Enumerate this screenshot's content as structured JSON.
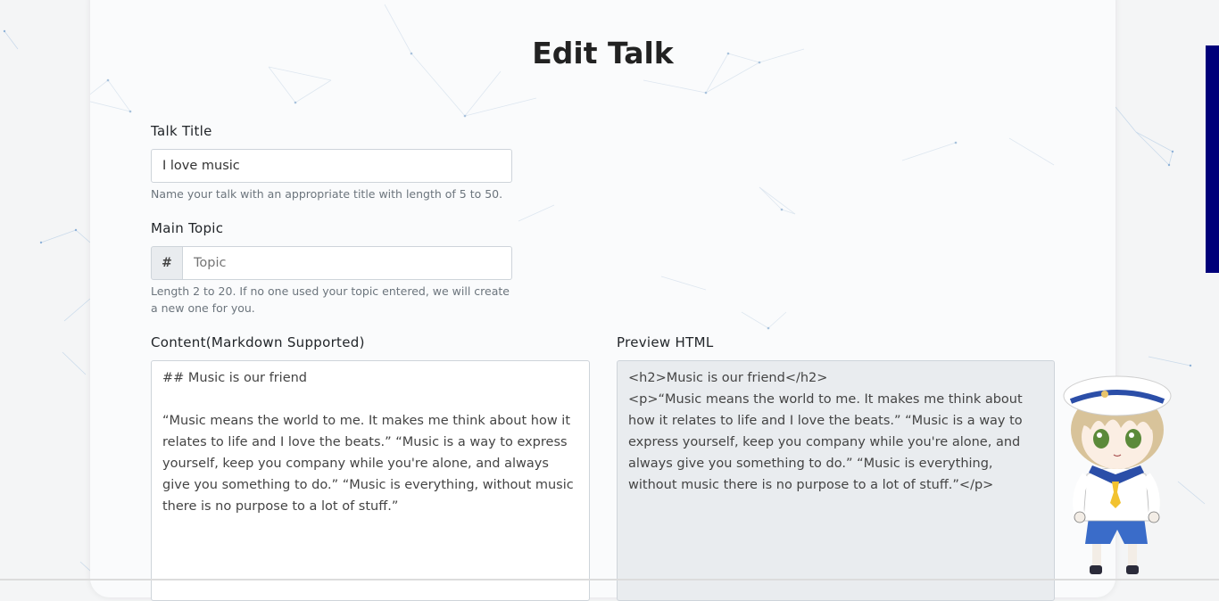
{
  "page": {
    "title": "Edit Talk"
  },
  "form": {
    "title_label": "Talk Title",
    "title_value": "I love music",
    "title_help": "Name your talk with an appropriate title with length of 5 to 50.",
    "topic_label": "Main Topic",
    "topic_prefix": "#",
    "topic_placeholder": "Topic",
    "topic_help": "Length 2 to 20. If no one used your topic entered, we will create a new one for you.",
    "content_label": "Content(Markdown Supported)",
    "content_value": "## Music is our friend\n\n“Music means the world to me. It makes me think about how it relates to life and I love the beats.” “Music is a way to express yourself, keep you company while you're alone, and always give you something to do.” “Music is everything, without music there is no purpose to a lot of stuff.”",
    "preview_label": "Preview HTML",
    "preview_value": "<h2>Music is our friend</h2>\n<p>“Music means the world to me. It makes me think about how it relates to life and I love the beats.” “Music is a way to express yourself, keep you company while you're alone, and always give you something to do.” “Music is everything, without music there is no purpose to a lot of stuff.”</p>"
  },
  "colors": {
    "side_bar": "#00007a",
    "preview_bg": "#e9ecef"
  },
  "icons": {
    "mascot": "sailor-boy-mascot"
  }
}
